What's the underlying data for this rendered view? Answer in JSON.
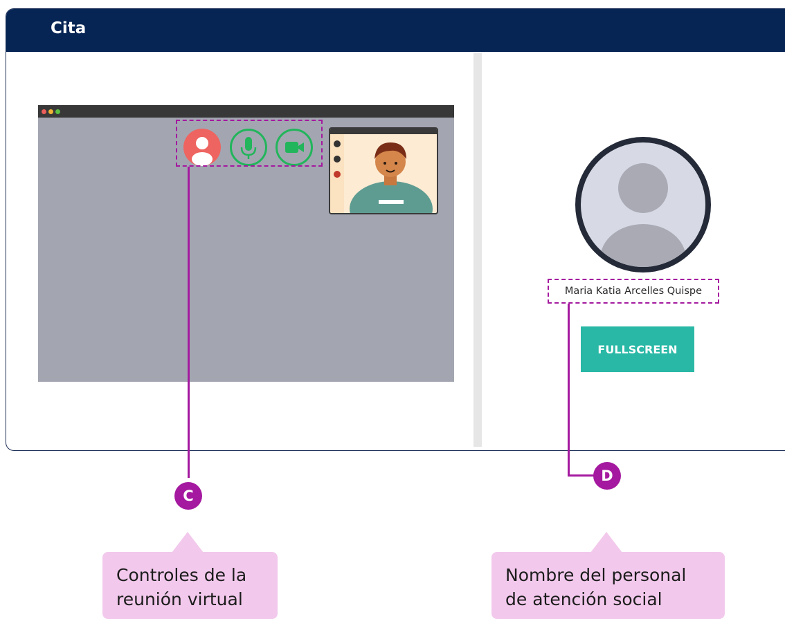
{
  "header": {
    "title": "Cita"
  },
  "meeting_controls": {
    "avatar_icon": "user-avatar-icon",
    "mic_icon": "microphone-icon",
    "camera_icon": "video-camera-icon",
    "accent_color": "#22b55b"
  },
  "profile": {
    "name": "Maria Katia Arcelles Quispe",
    "avatar_icon": "user-silhouette-icon",
    "fullscreen_label": "FULLSCREEN"
  },
  "annotations": {
    "c": {
      "marker": "C",
      "text_line1": "Controles de la",
      "text_line2": "reunión virtual"
    },
    "d": {
      "marker": "D",
      "text_line1": "Nombre del personal",
      "text_line2": "de atención social"
    },
    "color": "#a4199f",
    "callout_color": "#f2c9ec"
  },
  "colors": {
    "header": "#062454",
    "button": "#29b8a6"
  }
}
